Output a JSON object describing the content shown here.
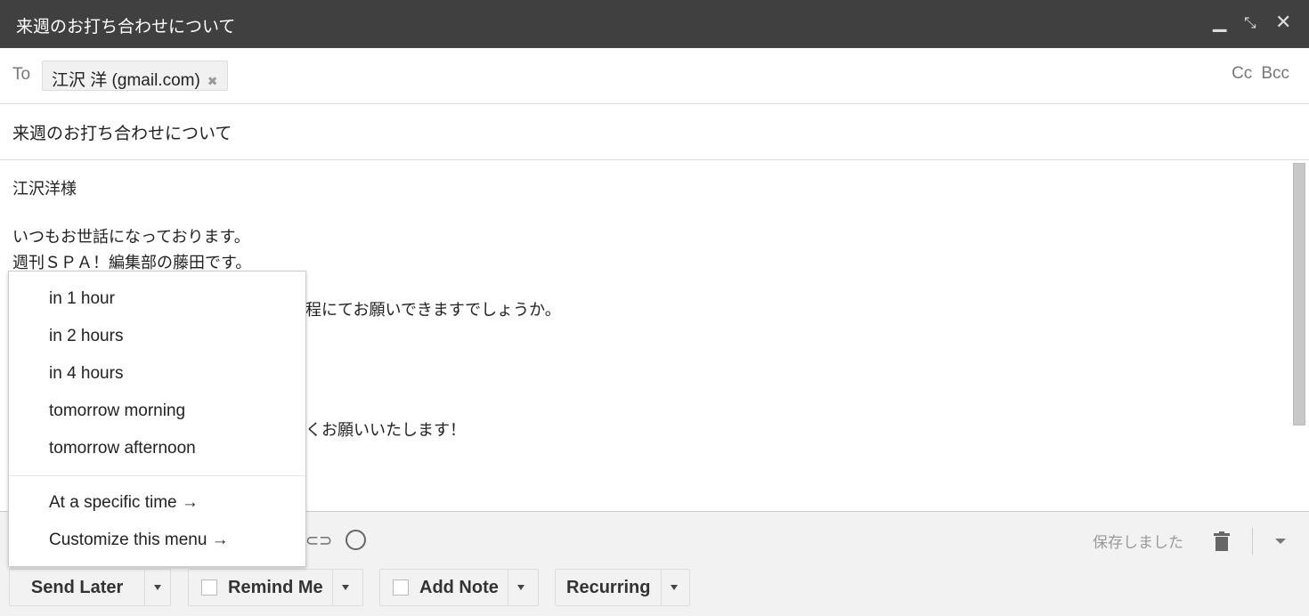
{
  "window": {
    "title": "来週のお打ち合わせについて",
    "minimize_icon": "minimize-icon",
    "exit_fullscreen_icon": "exit-fullscreen-icon",
    "close_icon": "close-icon"
  },
  "recipients": {
    "to_label": "To",
    "chips": [
      {
        "name": "江沢 洋 (gmail.com)"
      }
    ],
    "cc": "Cc",
    "bcc": "Bcc"
  },
  "subject": "来週のお打ち合わせについて",
  "body": {
    "lines": [
      "江沢洋様",
      "",
      "いつもお世話になっております。",
      "週刊ＳＰＡ！編集部の藤田です。"
    ],
    "fragment_1": "程にてお願いできますでしょうか。",
    "fragment_2": "くお願いいたします！"
  },
  "send_later_menu": {
    "items": [
      "in 1 hour",
      "in 2 hours",
      "in 4 hours",
      "tomorrow morning",
      "tomorrow afternoon"
    ],
    "extra": [
      "At a specific time →",
      "Customize this menu →"
    ]
  },
  "toolbar": {
    "saved_status": "保存しました",
    "link_icon": "link-icon",
    "emoji_icon": "emoji-icon",
    "trash_icon": "trash-icon",
    "more_icon": "more-options-icon"
  },
  "buttons": {
    "send_later": "Send Later",
    "remind_me": "Remind Me",
    "add_note": "Add Note",
    "recurring": "Recurring"
  }
}
